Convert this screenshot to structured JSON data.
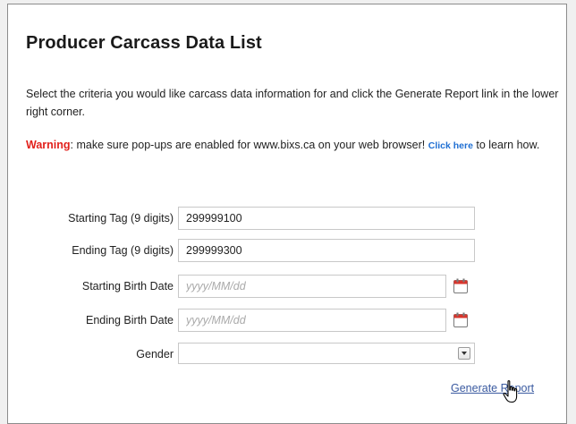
{
  "page": {
    "title": "Producer Carcass Data List",
    "intro": "Select the criteria you would like carcass data information for and click the Generate Report link in the lower right corner.",
    "warning": {
      "label": "Warning",
      "text_before_link": ": make sure pop-ups are enabled for www.bixs.ca on your web browser! ",
      "link_text": "Click here",
      "text_after_link": " to learn how."
    }
  },
  "form": {
    "starting_tag": {
      "label": "Starting Tag (9 digits)",
      "value": "299999100"
    },
    "ending_tag": {
      "label": "Ending Tag (9 digits)",
      "value": "299999300"
    },
    "starting_birth_date": {
      "label": "Starting Birth Date",
      "placeholder": "yyyy/MM/dd",
      "value": ""
    },
    "ending_birth_date": {
      "label": "Ending Birth Date",
      "placeholder": "yyyy/MM/dd",
      "value": ""
    },
    "gender": {
      "label": "Gender",
      "selected": ""
    }
  },
  "actions": {
    "generate_report": "Generate Report"
  },
  "icons": {
    "calendar": "calendar-icon",
    "dropdown": "chevron-down-icon",
    "cursor": "hand-pointer-icon"
  },
  "colors": {
    "warning": "#e2211c",
    "link": "#1f6fd3",
    "calendar_accent": "#d9342b"
  }
}
